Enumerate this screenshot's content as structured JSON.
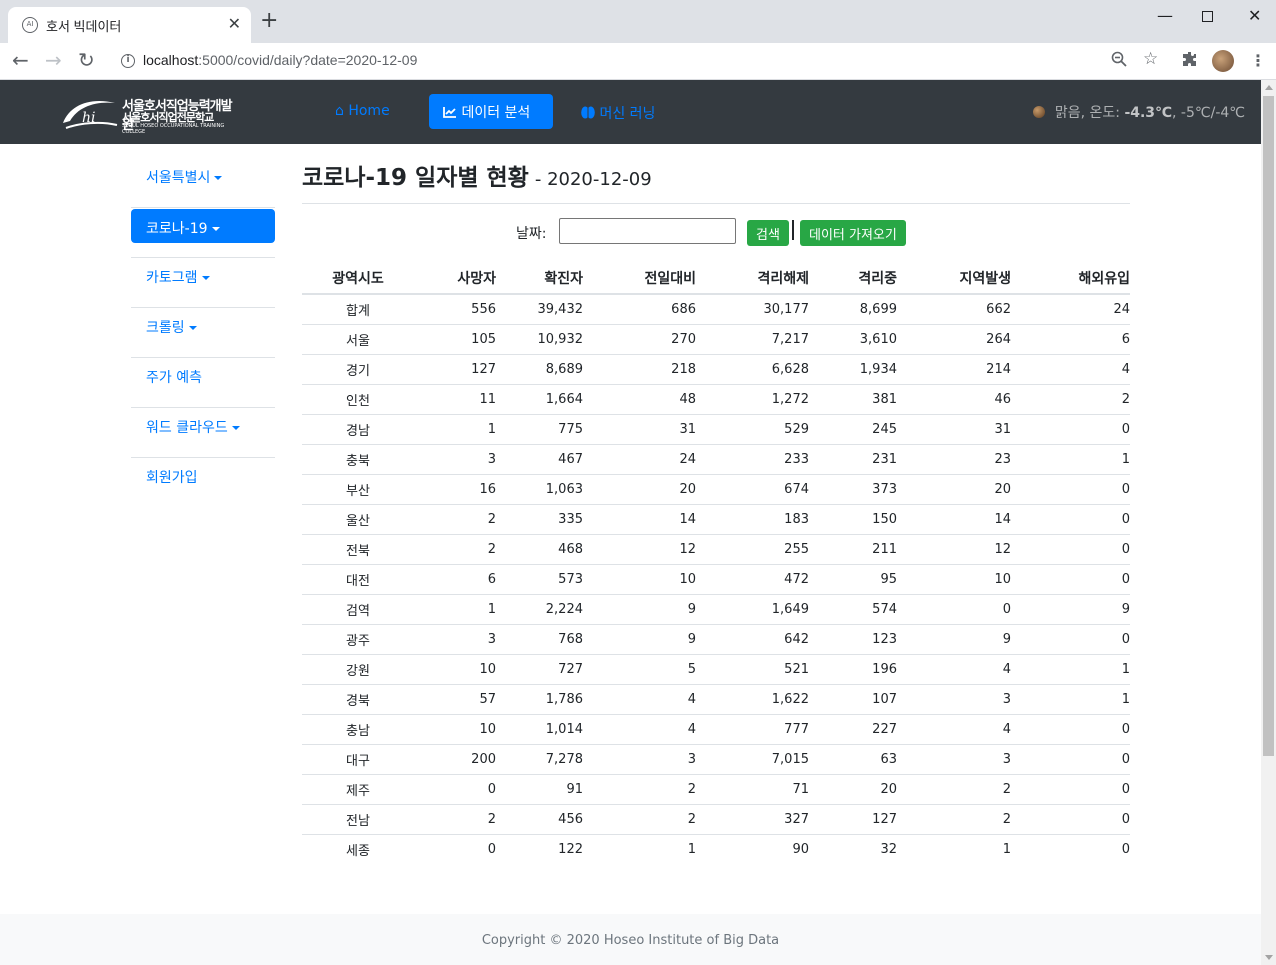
{
  "browser": {
    "tab_title": "호서 빅데이터",
    "tab_favicon": "AI",
    "url_host": "localhost",
    "url_rest": ":5000/covid/daily?date=2020-12-09"
  },
  "navbar": {
    "logo_line1": "서울호서직업능력개발원",
    "logo_line2": "서울호서직업전문학교",
    "logo_line3": "SEOUL HOSEO OCCUPATIONAL TRAINING COLLEGE",
    "home": "Home",
    "data_analysis": "데이터 분석",
    "machine_learning": "머신 러닝",
    "weather_desc": "맑음, 온도:",
    "weather_temp": "-4.3℃",
    "weather_range": ", -5℃/-4℃"
  },
  "sidebar": {
    "items": [
      {
        "label": "서울특별시",
        "dropdown": true
      },
      {
        "label": "코로나-19",
        "dropdown": true,
        "active": true
      },
      {
        "label": "카토그램",
        "dropdown": true
      },
      {
        "label": "크롤링",
        "dropdown": true
      },
      {
        "label": "주가 예측",
        "dropdown": false
      },
      {
        "label": "워드 클라우드",
        "dropdown": true
      },
      {
        "label": "회원가입",
        "dropdown": false
      }
    ]
  },
  "main": {
    "title": "코로나-19 일자별 현황",
    "date_suffix": "- 2020-12-09",
    "date_label": "날짜:",
    "date_value": "",
    "search_button": "검색",
    "fetch_button": "데이터 가져오기"
  },
  "table": {
    "headers": [
      "광역시도",
      "사망자",
      "확진자",
      "전일대비",
      "격리해제",
      "격리중",
      "지역발생",
      "해외유입"
    ],
    "rows": [
      [
        "합계",
        "556",
        "39,432",
        "686",
        "30,177",
        "8,699",
        "662",
        "24"
      ],
      [
        "서울",
        "105",
        "10,932",
        "270",
        "7,217",
        "3,610",
        "264",
        "6"
      ],
      [
        "경기",
        "127",
        "8,689",
        "218",
        "6,628",
        "1,934",
        "214",
        "4"
      ],
      [
        "인천",
        "11",
        "1,664",
        "48",
        "1,272",
        "381",
        "46",
        "2"
      ],
      [
        "경남",
        "1",
        "775",
        "31",
        "529",
        "245",
        "31",
        "0"
      ],
      [
        "충북",
        "3",
        "467",
        "24",
        "233",
        "231",
        "23",
        "1"
      ],
      [
        "부산",
        "16",
        "1,063",
        "20",
        "674",
        "373",
        "20",
        "0"
      ],
      [
        "울산",
        "2",
        "335",
        "14",
        "183",
        "150",
        "14",
        "0"
      ],
      [
        "전북",
        "2",
        "468",
        "12",
        "255",
        "211",
        "12",
        "0"
      ],
      [
        "대전",
        "6",
        "573",
        "10",
        "472",
        "95",
        "10",
        "0"
      ],
      [
        "검역",
        "1",
        "2,224",
        "9",
        "1,649",
        "574",
        "0",
        "9"
      ],
      [
        "광주",
        "3",
        "768",
        "9",
        "642",
        "123",
        "9",
        "0"
      ],
      [
        "강원",
        "10",
        "727",
        "5",
        "521",
        "196",
        "4",
        "1"
      ],
      [
        "경북",
        "57",
        "1,786",
        "4",
        "1,622",
        "107",
        "3",
        "1"
      ],
      [
        "충남",
        "10",
        "1,014",
        "4",
        "777",
        "227",
        "4",
        "0"
      ],
      [
        "대구",
        "200",
        "7,278",
        "3",
        "7,015",
        "63",
        "3",
        "0"
      ],
      [
        "제주",
        "0",
        "91",
        "2",
        "71",
        "20",
        "2",
        "0"
      ],
      [
        "전남",
        "2",
        "456",
        "2",
        "327",
        "127",
        "2",
        "0"
      ],
      [
        "세종",
        "0",
        "122",
        "1",
        "90",
        "32",
        "1",
        "0"
      ]
    ]
  },
  "footer": {
    "copyright": "Copyright © 2020 Hoseo Institute of Big Data"
  }
}
